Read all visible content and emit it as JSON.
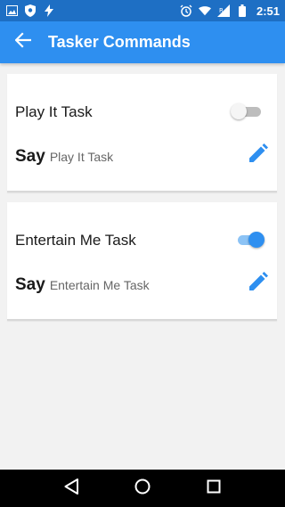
{
  "status_bar": {
    "time": "2:51",
    "left_icons": [
      "image-icon",
      "shield-icon",
      "flash-icon"
    ],
    "right_icons": [
      "alarm-icon",
      "wifi-icon",
      "signal-icon",
      "battery-icon"
    ]
  },
  "app_bar": {
    "title": "Tasker Commands",
    "back_icon": "arrow-back-icon"
  },
  "tasks": [
    {
      "title": "Play It Task",
      "enabled": false,
      "say_label": "Say",
      "say_text": "Play It Task"
    },
    {
      "title": "Entertain Me Task",
      "enabled": true,
      "say_label": "Say",
      "say_text": "Entertain Me Task"
    }
  ],
  "nav_bar": {
    "icons": [
      "back-triangle-icon",
      "home-circle-icon",
      "recents-square-icon"
    ]
  },
  "colors": {
    "primary": "#2e8ff0",
    "primary_dark": "#1e6fc4",
    "background": "#f2f2f2",
    "accent": "#2e8ff0"
  }
}
